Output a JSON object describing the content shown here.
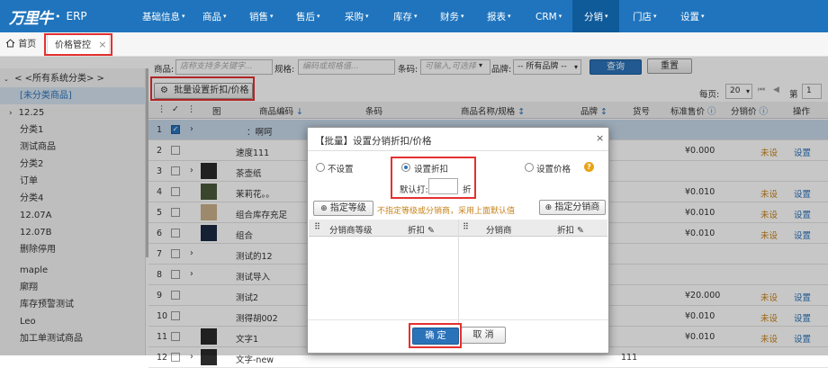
{
  "nav": {
    "logo_mark": "万里牛",
    "logo_suffix": "ERP",
    "items": [
      "基础信息",
      "商品",
      "销售",
      "售后",
      "采购",
      "库存",
      "财务",
      "报表",
      "CRM",
      "分销",
      "门店",
      "设置"
    ]
  },
  "tabs": {
    "home": "首页",
    "active": "价格管控",
    "close": "×"
  },
  "sidebar": {
    "root": "< <所有系统分类> >",
    "items": [
      "[未分类商品]",
      "12.25",
      "分类1",
      "测试商品",
      "分类2",
      "订单",
      "分类4",
      "12.07A",
      "12.07B",
      "删除停用",
      "maple",
      "库存预警测试",
      "Leo",
      "加工单测试商品"
    ],
    "extra": "廓翔"
  },
  "filter": {
    "product_label": "商品:",
    "product_placeholder": "店称支持多关键字...",
    "spec_label": "规格:",
    "spec_placeholder": "编码或规格值...",
    "barcode_label": "条码:",
    "barcode_placeholder": "可输入,可选择",
    "brand_label": "品牌:",
    "brand_value": "-- 所有品牌 --",
    "query_button": "查询",
    "reset_button": "重置",
    "batch_button": "批量设置折扣/价格",
    "per_page_label": "每页:",
    "per_page_value": "20",
    "page_label": "第",
    "page_value": "1"
  },
  "table": {
    "headers": [
      "图",
      "商品编码",
      "条码",
      "商品名称/规格",
      "品牌",
      "货号",
      "标准售价",
      "分销价",
      "操作"
    ],
    "rows": [
      {
        "n": "1",
        "code": "：啊呵",
        "price": "",
        "dist": "",
        "op": "",
        "checked": true,
        "expand": true,
        "thumb": ""
      },
      {
        "n": "2",
        "code": "速度111",
        "price": "¥0.000",
        "dist": "未设",
        "op": "设置",
        "checked": false,
        "expand": false,
        "thumb": ""
      },
      {
        "n": "3",
        "code": "茶壶纸",
        "price": "",
        "dist": "",
        "op": "",
        "checked": false,
        "expand": true,
        "thumb": "dark"
      },
      {
        "n": "4",
        "code": "茉莉花。。",
        "price": "¥0.010",
        "dist": "未设",
        "op": "设置",
        "checked": false,
        "expand": false,
        "thumb": "flower"
      },
      {
        "n": "5",
        "code": "组合库存充足",
        "price": "¥0.010",
        "dist": "未设",
        "op": "设置",
        "checked": false,
        "expand": false,
        "thumb": "tan"
      },
      {
        "n": "6",
        "code": "组合",
        "price": "¥0.010",
        "dist": "未设",
        "op": "设置",
        "checked": false,
        "expand": false,
        "thumb": "night"
      },
      {
        "n": "7",
        "code": "测试的12",
        "price": "",
        "dist": "",
        "op": "",
        "checked": false,
        "expand": true,
        "thumb": ""
      },
      {
        "n": "8",
        "code": "测试导入",
        "price": "",
        "dist": "",
        "op": "",
        "checked": false,
        "expand": true,
        "thumb": ""
      },
      {
        "n": "9",
        "code": "测试2",
        "price": "¥20.000",
        "dist": "未设",
        "op": "设置",
        "checked": false,
        "expand": false,
        "thumb": ""
      },
      {
        "n": "10",
        "code": "测得胡002",
        "price": "¥0.010",
        "dist": "未设",
        "op": "设置",
        "checked": false,
        "expand": false,
        "thumb": ""
      },
      {
        "n": "11",
        "code": "文字1",
        "price": "¥0.010",
        "dist": "未设",
        "op": "设置",
        "checked": false,
        "expand": false,
        "thumb": "dark"
      },
      {
        "n": "12",
        "code": "文字-new",
        "price": "",
        "dist": "",
        "op": "",
        "checked": false,
        "expand": true,
        "thumb": "dark"
      }
    ],
    "row12_extra": "111"
  },
  "dialog": {
    "title": "【批量】设置分销折扣/价格",
    "close": "×",
    "opt_none": "不设置",
    "opt_discount": "设置折扣",
    "opt_price": "设置价格",
    "default_label": "默认打:",
    "discount_unit": "折",
    "level_button": "指定等级",
    "hint": "不指定等级或分销商，采用上面默认值",
    "dealer_button": "指定分销商",
    "col_level": "分销商等级",
    "col_discount1": "折扣",
    "col_dealer": "分销商",
    "col_discount2": "折扣",
    "ok_button": "确 定",
    "cancel_button": "取 消"
  }
}
